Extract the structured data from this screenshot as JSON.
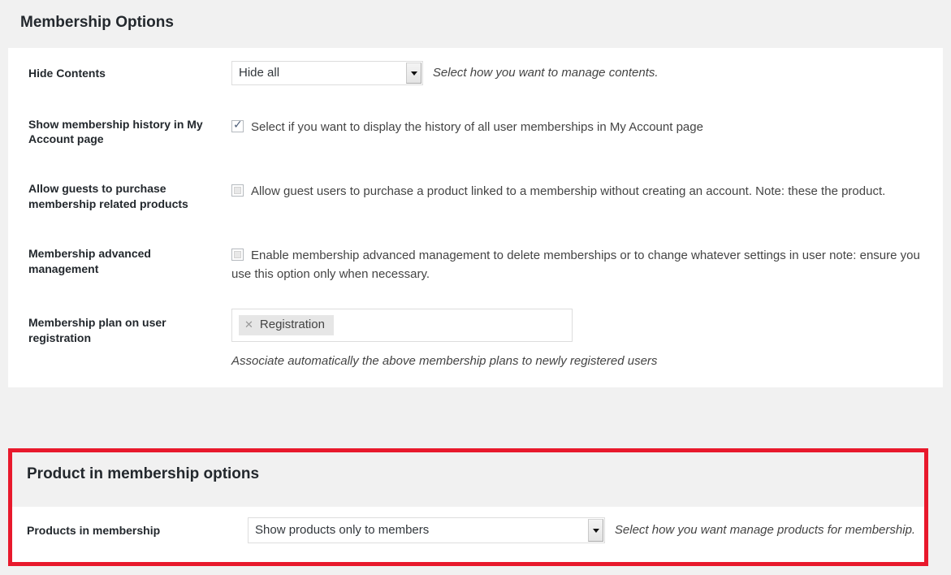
{
  "page": {
    "title": "Membership Options"
  },
  "colors": {
    "page_background": "#f1f1f1",
    "panel_background": "#ffffff",
    "highlight_border": "#e8192c",
    "text": "#23282d"
  },
  "settings": {
    "rows": [
      {
        "label": "Hide Contents",
        "control": "select",
        "value": "Hide all",
        "hint": "Select how you want to manage contents."
      },
      {
        "label": "Show membership history in My Account page",
        "control": "checkbox",
        "checked": true,
        "checkbox_label": "Select if you want to display the history of all user memberships in My Account page"
      },
      {
        "label": "Allow guests to purchase membership related products",
        "control": "checkbox",
        "checked": false,
        "checkbox_label": "Allow guest users to purchase a product linked to a membership without creating an account. Note: these the product."
      },
      {
        "label": "Membership advanced management",
        "control": "checkbox",
        "checked": false,
        "checkbox_label": "Enable membership advanced management to delete memberships or to change whatever settings in user note: ensure you use this option only when necessary."
      },
      {
        "label": "Membership plan on user registration",
        "control": "tokens",
        "tokens": [
          {
            "label": "Registration",
            "remove_icon": "close-icon"
          }
        ],
        "description": "Associate automatically the above membership plans to newly registered users"
      }
    ]
  },
  "product_section": {
    "title": "Product in membership options",
    "row": {
      "label": "Products in membership",
      "value": "Show products only to members",
      "hint": "Select how you want manage products for membership."
    }
  }
}
